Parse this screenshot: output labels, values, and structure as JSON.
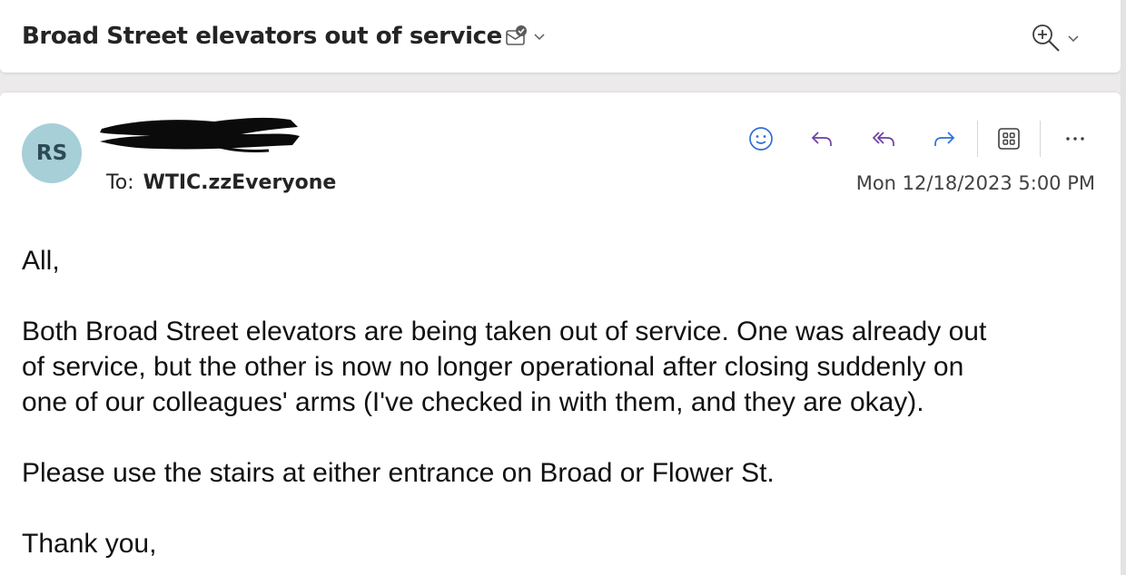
{
  "subject": {
    "title": "Broad Street elevators out of service",
    "icons": [
      "mark-read-icon",
      "chevron-down-icon",
      "zoom-in-icon",
      "chevron-down-icon"
    ]
  },
  "message": {
    "avatar_initials": "RS",
    "avatar_color": "#a6cfd8",
    "to_label": "To:",
    "to_value": "WTIC.zzEveryone",
    "date": "Mon 12/18/2023 5:00 PM",
    "actions": [
      "emoji-react-icon",
      "reply-icon",
      "reply-all-icon",
      "forward-icon",
      "apps-icon",
      "more-icon"
    ],
    "accent_color": "#6b3fa0",
    "forward_color": "#2f6fd6",
    "body": {
      "greeting": "All,",
      "paragraph": "Both Broad Street elevators are being taken out of service. One was already out\nof service, but the other is now no longer operational after closing suddenly on\none of our colleagues' arms (I've checked in with them, and they are okay).",
      "instruction": "Please use the stairs at either entrance on Broad or Flower St.",
      "closing": "Thank you,"
    }
  }
}
